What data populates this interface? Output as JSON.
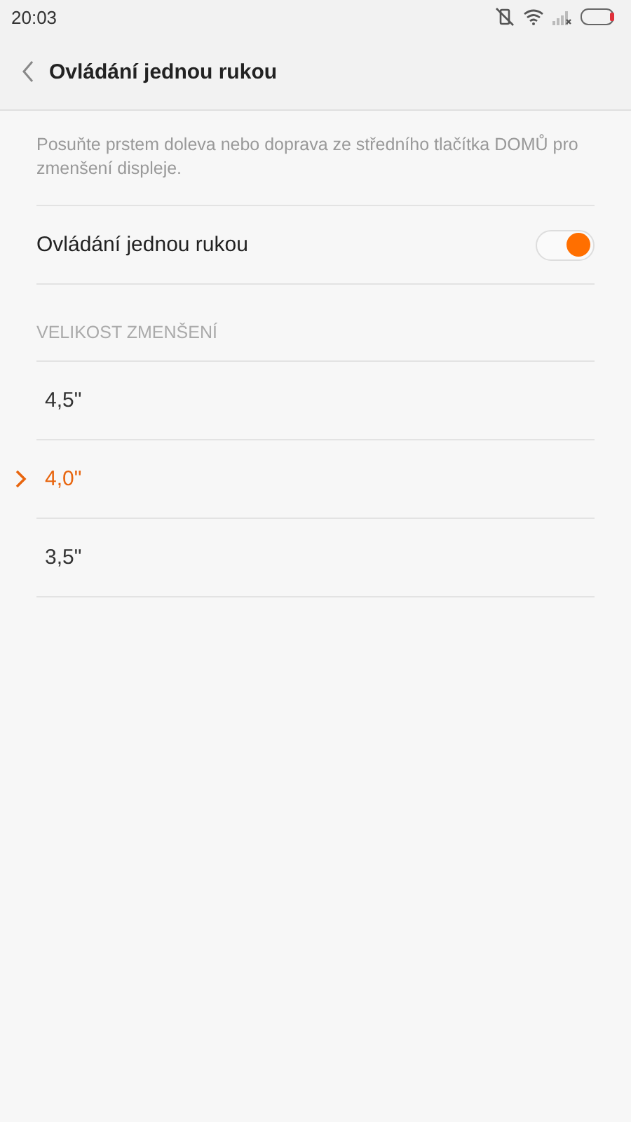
{
  "status_bar": {
    "time": "20:03"
  },
  "header": {
    "title": "Ovládání jednou rukou"
  },
  "description": "Posuňte prstem doleva nebo doprava ze středního tlačítka DOMŮ pro zmenšení displeje.",
  "toggle": {
    "label": "Ovládání jednou rukou",
    "on": true
  },
  "section": {
    "title": "VELIKOST ZMENŠENÍ"
  },
  "sizes": [
    {
      "label": "4,5\"",
      "selected": false
    },
    {
      "label": "4,0\"",
      "selected": true
    },
    {
      "label": "3,5\"",
      "selected": false
    }
  ]
}
